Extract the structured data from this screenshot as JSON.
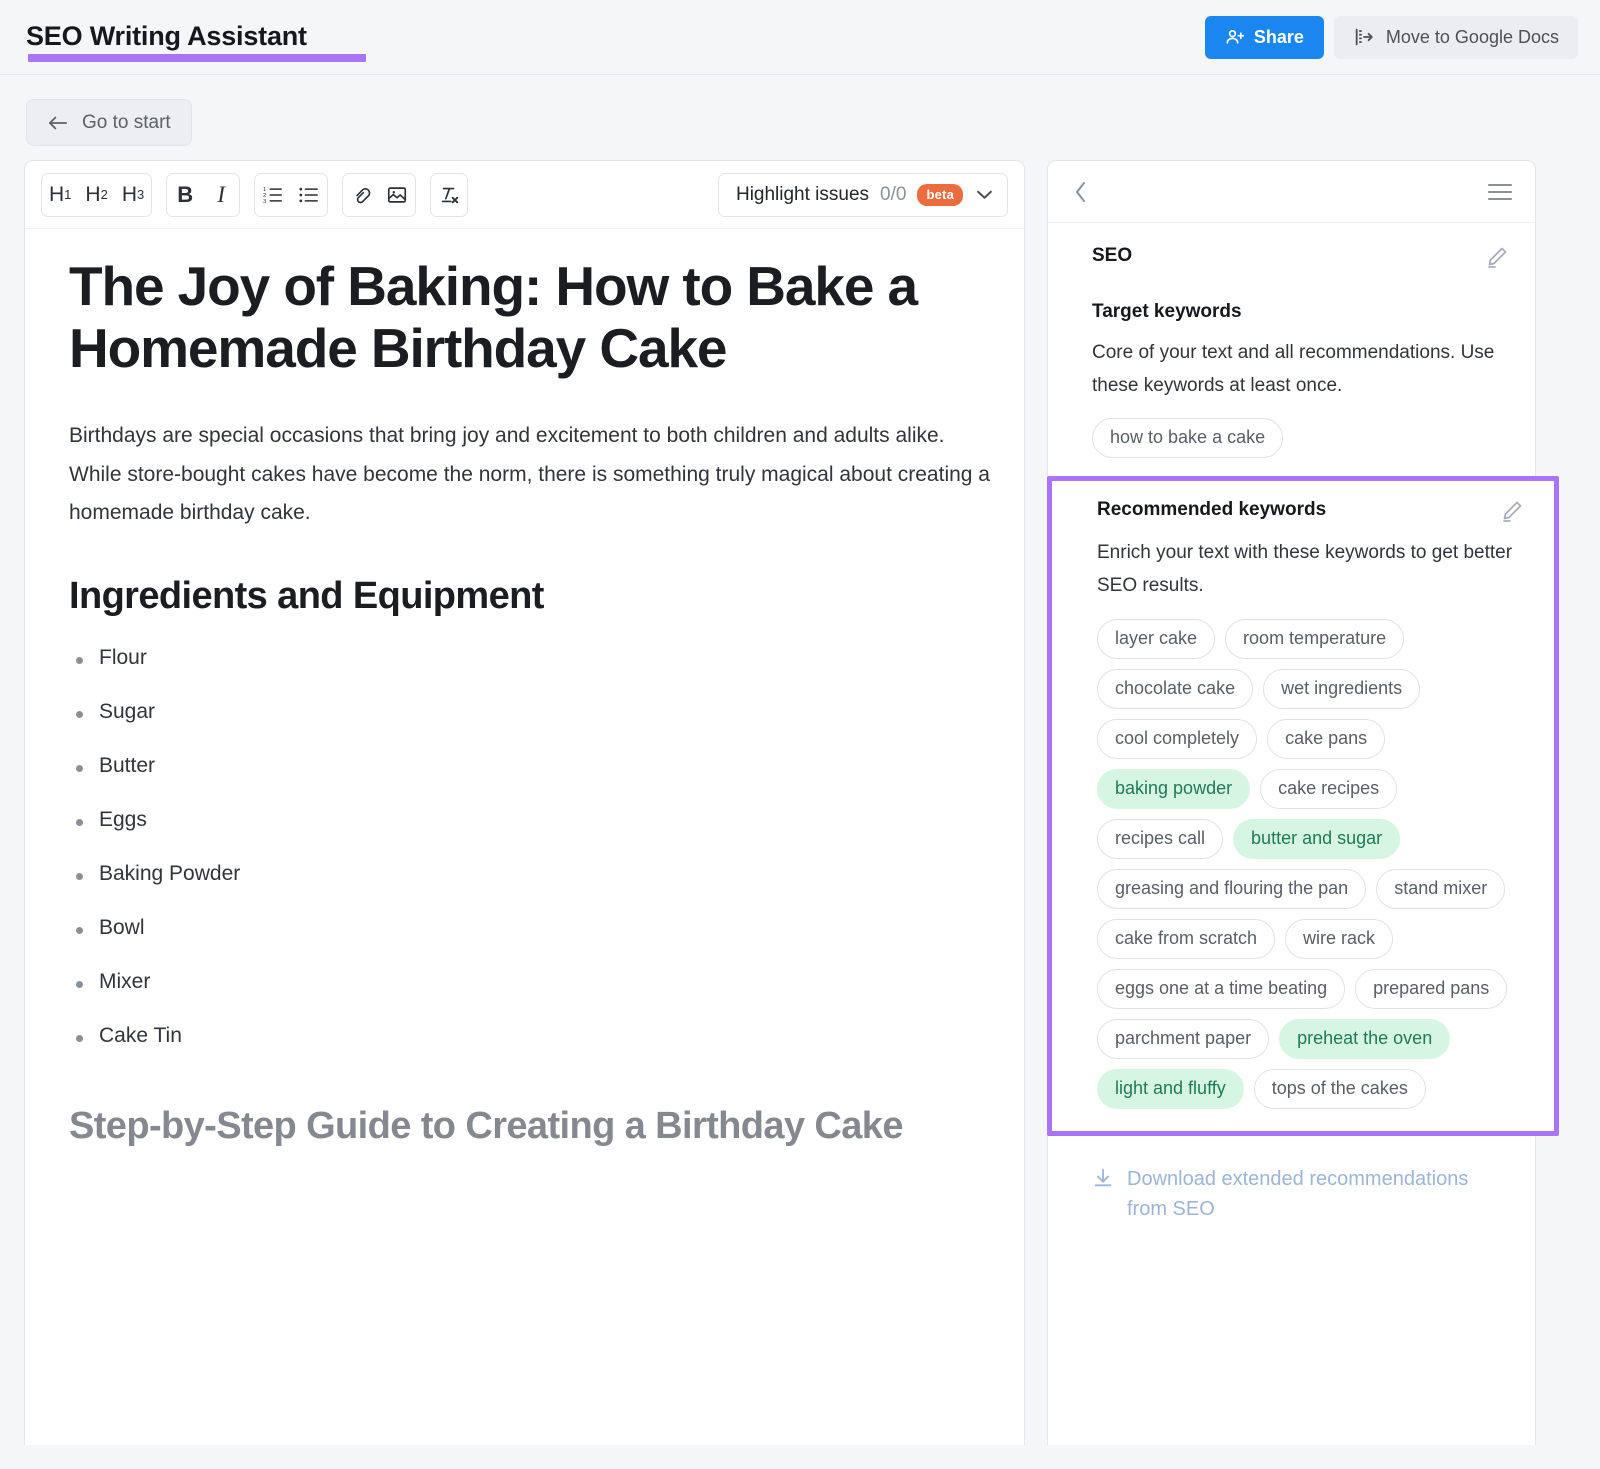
{
  "header": {
    "title": "SEO Writing Assistant",
    "accent_color": "#ab73f5",
    "share_label": "Share",
    "share_icon": "add-user-icon",
    "share_color": "#1a87f0",
    "move_label": "Move to Google Docs",
    "move_icon": "move-out-icon"
  },
  "nav": {
    "go_to_start_label": "Go to start",
    "back_arrow_icon": "arrow-left-icon"
  },
  "editor": {
    "toolbar": {
      "heading_buttons": [
        {
          "label": "H",
          "sub": "1",
          "name": "heading-1-button"
        },
        {
          "label": "H",
          "sub": "2",
          "name": "heading-2-button"
        },
        {
          "label": "H",
          "sub": "3",
          "name": "heading-3-button"
        }
      ],
      "bold_label": "B",
      "italic_label": "I",
      "ordered_list_icon": "ordered-list-icon",
      "bullet_list_icon": "bullet-list-icon",
      "link_icon": "link-icon",
      "image_icon": "image-icon",
      "clear_format_icon": "clear-formatting-icon",
      "highlight_label": "Highlight issues",
      "highlight_count": "0/0",
      "beta_label": "beta",
      "beta_color": "#ed6c3d",
      "chevron_icon": "chevron-down-icon"
    },
    "document": {
      "title": "The Joy of Baking: How to Bake a Homemade Birthday Cake",
      "intro": "Birthdays are special occasions that bring joy and excitement to both children and adults alike. While store-bought cakes have become the norm, there is something truly magical about creating a homemade birthday cake.",
      "section_heading": "Ingredients and Equipment",
      "ingredients": [
        "Flour",
        "Sugar",
        "Butter",
        "Eggs",
        "Baking Powder",
        "Bowl",
        "Mixer",
        "Cake Tin"
      ],
      "next_heading": "Step-by-Step Guide to Creating a Birthday Cake"
    }
  },
  "panel": {
    "collapse_icon": "chevron-left-icon",
    "menu_icon": "hamburger-menu-icon",
    "seo": {
      "title": "SEO",
      "edit_icon": "pencil-edit-icon",
      "target_keywords": {
        "heading": "Target keywords",
        "description": "Core of your text and all recommendations. Use these keywords at least once.",
        "chips": [
          {
            "text": "how to bake a cake",
            "used": false
          }
        ]
      },
      "recommended_keywords": {
        "heading": "Recommended keywords",
        "edit_icon": "pencil-edit-icon",
        "description": "Enrich your text with these keywords to get better SEO results.",
        "highlight_color": "#ab73f5",
        "used_chip_bg": "#d6f5e3",
        "used_chip_text": "#1f7a57",
        "chips": [
          {
            "text": "layer cake",
            "used": false
          },
          {
            "text": "room temperature",
            "used": false
          },
          {
            "text": "chocolate cake",
            "used": false
          },
          {
            "text": "wet ingredients",
            "used": false
          },
          {
            "text": "cool completely",
            "used": false
          },
          {
            "text": "cake pans",
            "used": false
          },
          {
            "text": "baking powder",
            "used": true
          },
          {
            "text": "cake recipes",
            "used": false
          },
          {
            "text": "recipes call",
            "used": false
          },
          {
            "text": "butter and sugar",
            "used": true
          },
          {
            "text": "greasing and flouring the pan",
            "used": false
          },
          {
            "text": "stand mixer",
            "used": false
          },
          {
            "text": "cake from scratch",
            "used": false
          },
          {
            "text": "wire rack",
            "used": false
          },
          {
            "text": "eggs one at a time beating",
            "used": false
          },
          {
            "text": "prepared pans",
            "used": false
          },
          {
            "text": "parchment paper",
            "used": false
          },
          {
            "text": "preheat the oven",
            "used": true
          },
          {
            "text": "light and fluffy",
            "used": true
          },
          {
            "text": "tops of the cakes",
            "used": false
          }
        ]
      },
      "download_link": {
        "icon": "download-icon",
        "label": "Download extended recommendations from SEO"
      }
    }
  }
}
